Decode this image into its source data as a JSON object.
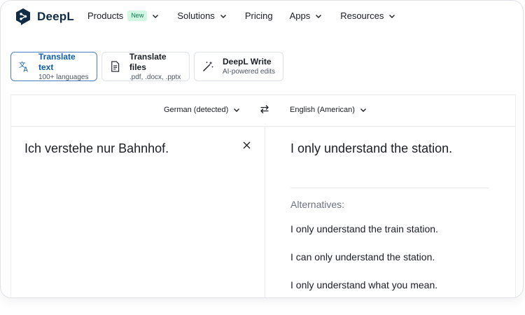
{
  "brand": {
    "name": "DeepL",
    "color": "#0f2b46"
  },
  "nav": {
    "products": "Products",
    "new_badge": "New",
    "solutions": "Solutions",
    "pricing": "Pricing",
    "apps": "Apps",
    "resources": "Resources"
  },
  "modes": [
    {
      "title": "Translate text",
      "subtitle": "100+ languages",
      "icon": "translate-icon",
      "active": true
    },
    {
      "title": "Translate files",
      "subtitle": ".pdf, .docx, .pptx",
      "icon": "file-icon",
      "active": false
    },
    {
      "title": "DeepL Write",
      "subtitle": "AI-powered edits",
      "icon": "magic-wand-icon",
      "active": false
    }
  ],
  "translator": {
    "source_lang": "German (detected)",
    "target_lang": "English (American)",
    "source_text": "Ich verstehe nur Bahnhof.",
    "target_text": "I only understand the station.",
    "alternatives_label": "Alternatives:",
    "alternatives": [
      "I only understand the train station.",
      "I can only understand the station.",
      "I only understand what you mean."
    ]
  },
  "colors": {
    "accent": "#0b5cad",
    "active_border": "#4a7fc1",
    "badge_bg": "#d1f7e3",
    "badge_text": "#0a7a4a"
  }
}
